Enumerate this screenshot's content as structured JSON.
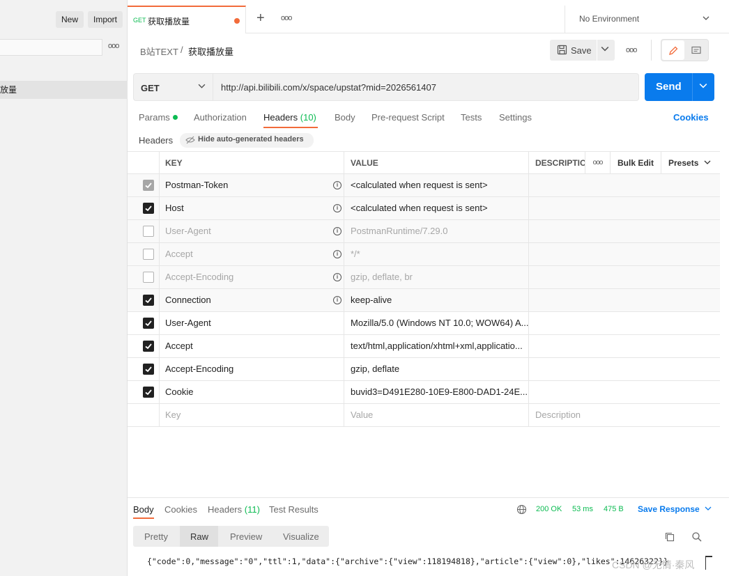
{
  "sidebar": {
    "new_label": "New",
    "import_label": "Import",
    "selected_item_label": "放量"
  },
  "tabs": {
    "active_method": "GET",
    "active_name": "获取播放量",
    "environment": "No Environment"
  },
  "breadcrumb": {
    "collection": "B站TEXT",
    "separator": "/",
    "request": "获取播放量",
    "save_label": "Save"
  },
  "request": {
    "method": "GET",
    "url": "http://api.bilibili.com/x/space/upstat?mid=2026561407",
    "send_label": "Send"
  },
  "request_tabs": [
    {
      "label": "Params",
      "indicator": true
    },
    {
      "label": "Authorization"
    },
    {
      "label": "Headers",
      "count": "(10)",
      "active": true
    },
    {
      "label": "Body"
    },
    {
      "label": "Pre-request Script"
    },
    {
      "label": "Tests"
    },
    {
      "label": "Settings"
    }
  ],
  "cookies_link": "Cookies",
  "headers_section": {
    "label": "Headers",
    "hide_label": "Hide auto-generated headers"
  },
  "headers_table": {
    "columns": {
      "key": "KEY",
      "value": "VALUE",
      "description": "DESCRIPTION",
      "bulk_edit": "Bulk Edit",
      "presets": "Presets"
    },
    "rows": [
      {
        "key": "Postman-Token",
        "value": "<calculated when request is sent>",
        "checked": "dim",
        "auto": true,
        "muted": false
      },
      {
        "key": "Host",
        "value": "<calculated when request is sent>",
        "checked": "on",
        "auto": true,
        "muted": false
      },
      {
        "key": "User-Agent",
        "value": "PostmanRuntime/7.29.0",
        "checked": "off",
        "auto": true,
        "muted": true
      },
      {
        "key": "Accept",
        "value": "*/*",
        "checked": "off",
        "auto": true,
        "muted": true
      },
      {
        "key": "Accept-Encoding",
        "value": "gzip, deflate, br",
        "checked": "off",
        "auto": true,
        "muted": true
      },
      {
        "key": "Connection",
        "value": "keep-alive",
        "checked": "on",
        "auto": true,
        "muted": false
      },
      {
        "key": "User-Agent",
        "value": "Mozilla/5.0 (Windows NT 10.0; WOW64) A...",
        "checked": "on",
        "auto": false,
        "muted": false
      },
      {
        "key": "Accept",
        "value": "text/html,application/xhtml+xml,applicatio...",
        "checked": "on",
        "auto": false,
        "muted": false
      },
      {
        "key": "Accept-Encoding",
        "value": "gzip, deflate",
        "checked": "on",
        "auto": false,
        "muted": false
      },
      {
        "key": "Cookie",
        "value": "buvid3=D491E280-10E9-E800-DAD1-24E...",
        "checked": "on",
        "auto": false,
        "muted": false
      }
    ],
    "placeholder": {
      "key": "Key",
      "value": "Value",
      "description": "Description"
    }
  },
  "response": {
    "tabs": [
      {
        "label": "Body",
        "active": true
      },
      {
        "label": "Cookies"
      },
      {
        "label": "Headers",
        "count": "(11)"
      },
      {
        "label": "Test Results"
      }
    ],
    "status": "200 OK",
    "time": "53 ms",
    "size": "475 B",
    "save_label": "Save Response",
    "formats": [
      "Pretty",
      "Raw",
      "Preview",
      "Visualize"
    ],
    "body": "{\"code\":0,\"message\":\"0\",\"ttl\":1,\"data\":{\"archive\":{\"view\":118194818},\"article\":{\"view\":0},\"likes\":14626322}}",
    "watermark": "CSDN @无情·秦风"
  },
  "colors": {
    "accent": "#f26b3a",
    "send": "#097bed",
    "success": "#0cbb52"
  }
}
